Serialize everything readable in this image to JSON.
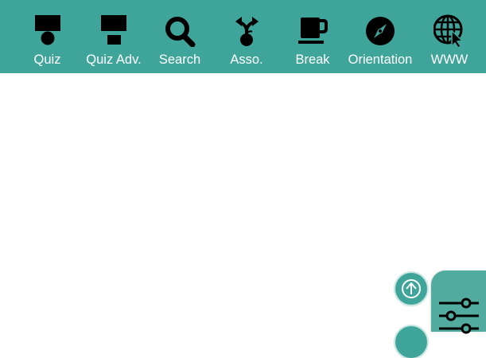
{
  "toolbar": {
    "items": [
      {
        "id": "quiz",
        "label": "Quiz",
        "icon": "quiz-icon"
      },
      {
        "id": "quiz-adv",
        "label": "Quiz Adv.",
        "icon": "quiz-adv-icon"
      },
      {
        "id": "search",
        "label": "Search",
        "icon": "search-icon"
      },
      {
        "id": "asso",
        "label": "Asso.",
        "icon": "association-icon"
      },
      {
        "id": "break",
        "label": "Break",
        "icon": "coffee-cup-icon"
      },
      {
        "id": "orientation",
        "label": "Orientation",
        "icon": "compass-icon"
      },
      {
        "id": "www",
        "label": "WWW",
        "icon": "globe-cursor-icon"
      }
    ],
    "background_color": "#3fa59a",
    "text_color": "#ffffff",
    "icon_color": "#000000"
  },
  "floating_buttons": [
    {
      "id": "scroll-up",
      "icon": "arrow-up-circle-icon"
    },
    {
      "id": "secondary",
      "icon": "circle-button-icon"
    }
  ],
  "settings_panel": {
    "icon": "sliders-icon",
    "color": "#52ab9f"
  }
}
